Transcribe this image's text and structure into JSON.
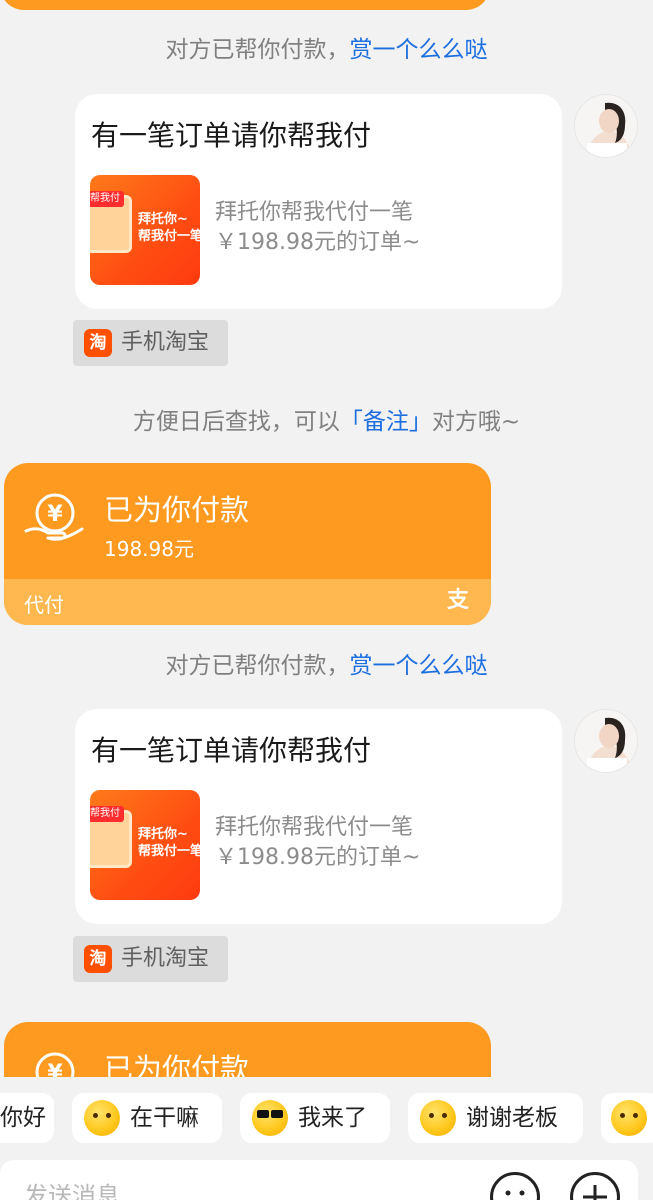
{
  "system_notices": {
    "paid_prefix": "对方已帮你付款，",
    "reward_link": "赏一个么么哒",
    "remark_prefix": "方便日后查找，可以",
    "remark_open": "「",
    "remark_link": "备注",
    "remark_close": "」",
    "remark_suffix": "对方哦~"
  },
  "order_request": {
    "title": "有一笔订单请你帮我付",
    "thumb_tag": "帮我付",
    "thumb_line1": "拜托你~",
    "thumb_line2": "帮我付一笔",
    "desc_line1": "拜托你帮我代付一笔",
    "desc_line2": "￥198.98元的订单~"
  },
  "source": {
    "icon_text": "淘",
    "label": "手机淘宝"
  },
  "payment_card": {
    "title": "已为你付款",
    "amount": "198.98元",
    "footer_label": "代付",
    "footer_mark": "支"
  },
  "quick_replies": [
    {
      "label": "你好",
      "icon": "smile-emoji-icon"
    },
    {
      "label": "在干嘛",
      "icon": "busy-emoji-icon"
    },
    {
      "label": "我来了",
      "icon": "sunglasses-emoji-icon"
    },
    {
      "label": "谢谢老板",
      "icon": "thanks-emoji-icon"
    }
  ],
  "input": {
    "placeholder": "发送消息"
  },
  "colors": {
    "accent_orange": "#fe9a1f",
    "link_blue": "#1d6fe0",
    "taobao_orange": "#ff5000"
  }
}
